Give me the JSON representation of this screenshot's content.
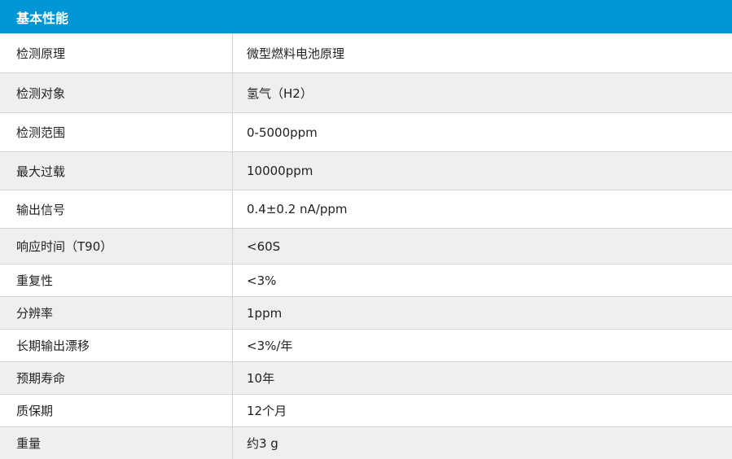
{
  "table": {
    "header": "基本性能",
    "rows": [
      {
        "label": "检测原理",
        "value": "微型燃料电池原理"
      },
      {
        "label": "检测对象",
        "value": "氢气（H2）"
      },
      {
        "label": "检测范围",
        "value": "0-5000ppm"
      },
      {
        "label": "最大过载",
        "value": "10000ppm"
      },
      {
        "label": "输出信号",
        "value": "0.4±0.2 nA/ppm"
      },
      {
        "label": "响应时间（T90）",
        "value": "<60S"
      },
      {
        "label": "重复性",
        "value": "<3%"
      },
      {
        "label": "分辨率",
        "value": "1ppm"
      },
      {
        "label": "长期输出漂移",
        "value": "<3%/年"
      },
      {
        "label": "预期寿命",
        "value": "10年"
      },
      {
        "label": "质保期",
        "value": "12个月"
      },
      {
        "label": "重量",
        "value": "约3 g"
      }
    ]
  },
  "colors": {
    "header_bg": "#0096d6",
    "alt_row_bg": "#efefef",
    "border": "#d4d4d4"
  }
}
